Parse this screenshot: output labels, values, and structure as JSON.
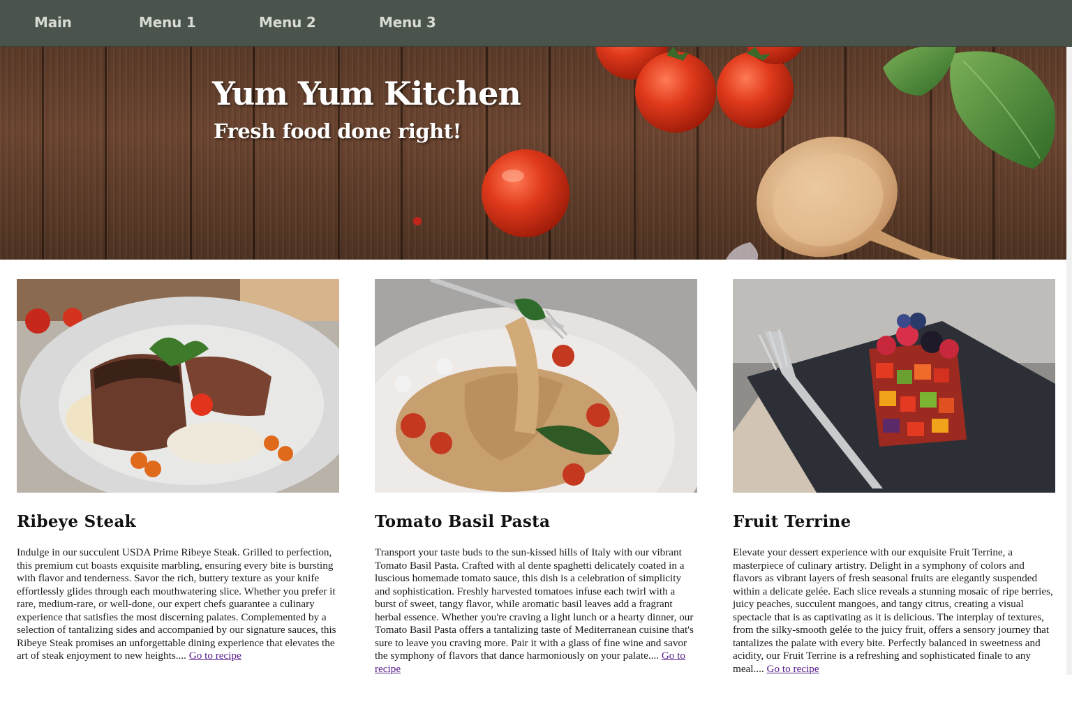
{
  "nav": {
    "items": [
      {
        "label": "Main"
      },
      {
        "label": "Menu 1"
      },
      {
        "label": "Menu 2"
      },
      {
        "label": "Menu 3"
      }
    ]
  },
  "hero": {
    "title": "Yum Yum Kitchen",
    "subtitle": "Fresh food done right!"
  },
  "cards": [
    {
      "title": "Ribeye Steak",
      "image_icon": "steak-plate-image",
      "description": "Indulge in our succulent USDA Prime Ribeye Steak. Grilled to perfection, this premium cut boasts exquisite marbling, ensuring every bite is bursting with flavor and tenderness. Savor the rich, buttery texture as your knife effortlessly glides through each mouthwatering slice. Whether you prefer it rare, medium-rare, or well-done, our expert chefs guarantee a culinary experience that satisfies the most discerning palates. Complemented by a selection of tantalizing sides and accompanied by our signature sauces, this Ribeye Steak promises an unforgettable dining experience that elevates the art of steak enjoyment to new heights....",
      "link_label": "Go to recipe"
    },
    {
      "title": "Tomato Basil Pasta",
      "image_icon": "pasta-plate-image",
      "description": "Transport your taste buds to the sun-kissed hills of Italy with our vibrant Tomato Basil Pasta. Crafted with al dente spaghetti delicately coated in a luscious homemade tomato sauce, this dish is a celebration of simplicity and sophistication. Freshly harvested tomatoes infuse each twirl with a burst of sweet, tangy flavor, while aromatic basil leaves add a fragrant herbal essence. Whether you're craving a light lunch or a hearty dinner, our Tomato Basil Pasta offers a tantalizing taste of Mediterranean cuisine that's sure to leave you craving more. Pair it with a glass of fine wine and savor the symphony of flavors that dance harmoniously on your palate....",
      "link_label": "Go to recipe"
    },
    {
      "title": "Fruit Terrine",
      "image_icon": "fruit-terrine-image",
      "description": "Elevate your dessert experience with our exquisite Fruit Terrine, a masterpiece of culinary artistry. Delight in a symphony of colors and flavors as vibrant layers of fresh seasonal fruits are elegantly suspended within a delicate gelée. Each slice reveals a stunning mosaic of ripe berries, juicy peaches, succulent mangoes, and tangy citrus, creating a visual spectacle that is as captivating as it is delicious. The interplay of textures, from the silky-smooth gelée to the juicy fruit, offers a sensory journey that tantalizes the palate with every bite. Perfectly balanced in sweetness and acidity, our Fruit Terrine is a refreshing and sophisticated finale to any meal....",
      "link_label": "Go to recipe"
    }
  ],
  "colors": {
    "nav_bg": "#4b544c",
    "nav_text": "#d8dbd5",
    "link": "#551a8b"
  }
}
